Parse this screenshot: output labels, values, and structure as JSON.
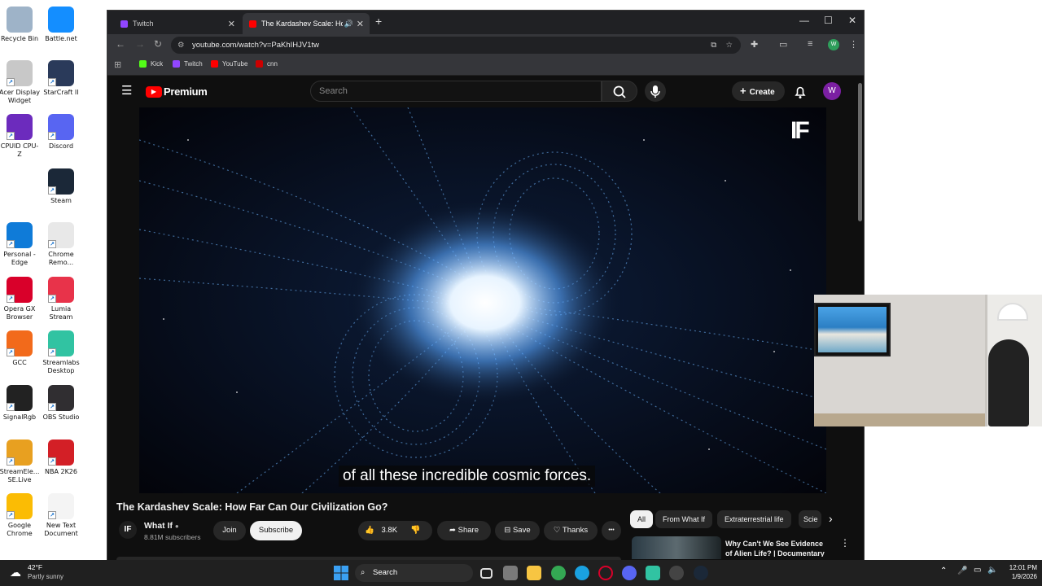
{
  "desktop": {
    "icons": [
      {
        "label": "Recycle Bin",
        "color": "#9eb3c8"
      },
      {
        "label": "Battle.net",
        "color": "#148eff"
      },
      {
        "label": "Acer Display Widget",
        "color": "#c8c8c8"
      },
      {
        "label": "StarCraft II",
        "color": "#2a3a5a"
      },
      {
        "label": "CPUID CPU-Z",
        "color": "#6c2bbd"
      },
      {
        "label": "Discord",
        "color": "#5865f2"
      },
      {
        "label": "Steam",
        "color": "#1b2838"
      },
      {
        "label": "Personal - Edge",
        "color": "#0f7bd8"
      },
      {
        "label": "Chrome Remo...",
        "color": "#e8e8e8"
      },
      {
        "label": "Opera GX Browser",
        "color": "#d9002a"
      },
      {
        "label": "Lumia Stream",
        "color": "#e8334a"
      },
      {
        "label": "GCC",
        "color": "#f26a1b"
      },
      {
        "label": "Streamlabs Desktop",
        "color": "#31c3a2"
      },
      {
        "label": "SignalRgb",
        "color": "#222222"
      },
      {
        "label": "OBS Studio",
        "color": "#302e31"
      },
      {
        "label": "StreamEle... SE.Live",
        "color": "#e8a020"
      },
      {
        "label": "NBA 2K26",
        "color": "#d31f26"
      },
      {
        "label": "Google Chrome",
        "color": "#fbbc04"
      },
      {
        "label": "New Text Document",
        "color": "#f4f4f4"
      }
    ]
  },
  "browser": {
    "tabs": [
      {
        "label": "Twitch",
        "fav_color": "#9146ff"
      },
      {
        "label": "The Kardashev Scale: How F",
        "fav_color": "#ff0000"
      }
    ],
    "url": "youtube.com/watch?v=PaKhIHJV1tw",
    "bookmarks": [
      {
        "label": "Kick",
        "color": "#53fc18"
      },
      {
        "label": "Twitch",
        "color": "#9146ff"
      },
      {
        "label": "YouTube",
        "color": "#ff0000"
      },
      {
        "label": "cnn",
        "color": "#cc0000"
      }
    ]
  },
  "youtube": {
    "logo_text": "Premium",
    "search_placeholder": "Search",
    "create_label": "Create",
    "avatar_letter": "W",
    "watermark": "IF",
    "caption": "of all these incredible cosmic forces.",
    "video_title": "The Kardashev Scale: How Far Can Our Civilization Go?",
    "channel": {
      "name": "What If",
      "subscribers": "8.81M subscribers",
      "avatar_text": "IF"
    },
    "join_label": "Join",
    "subscribe_label": "Subscribe",
    "like_count": "3.8K",
    "share_label": "Share",
    "save_label": "Save",
    "thanks_label": "Thanks",
    "more_label": "•••",
    "chips": [
      "All",
      "From What If",
      "Extraterrestrial life",
      "Scie"
    ],
    "recommended": {
      "title": "Why Can't We See Evidence of Alien Life? | Documentary"
    }
  },
  "taskbar": {
    "weather_temp": "42°F",
    "weather_desc": "Partly sunny",
    "search_label": "Search",
    "time": "12:01 PM",
    "date": "1/9/2026"
  }
}
